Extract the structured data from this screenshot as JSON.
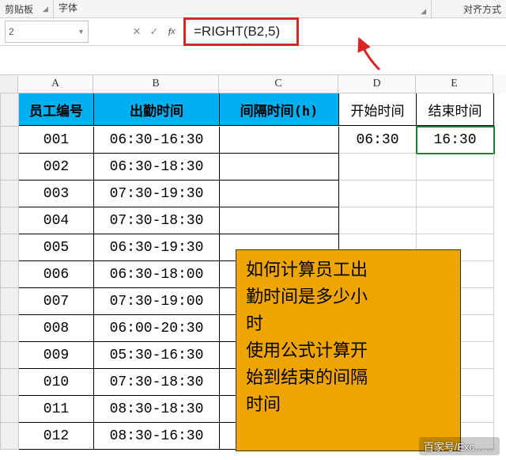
{
  "ribbon": {
    "clipboard": "剪贴板",
    "font": "字体",
    "alignment": "对齐方式"
  },
  "formula_bar": {
    "namebox": "2",
    "formula": "=RIGHT(B2,5)"
  },
  "columns": {
    "A": "A",
    "B": "B",
    "C": "C",
    "D": "D",
    "E": "E"
  },
  "headers": {
    "A": "员工编号",
    "B": "出勤时间",
    "C": "间隔时间(h)",
    "D": "开始时间",
    "E": "结束时间"
  },
  "rows": [
    {
      "A": "001",
      "B": "06:30-16:30",
      "C": "",
      "D": "06:30",
      "E": "16:30"
    },
    {
      "A": "002",
      "B": "06:30-18:30",
      "C": "",
      "D": "",
      "E": ""
    },
    {
      "A": "003",
      "B": "07:30-19:30",
      "C": "",
      "D": "",
      "E": ""
    },
    {
      "A": "004",
      "B": "07:30-18:30",
      "C": "",
      "D": "",
      "E": ""
    },
    {
      "A": "005",
      "B": "06:30-19:30",
      "C": "",
      "D": "",
      "E": ""
    },
    {
      "A": "006",
      "B": "06:30-18:00",
      "C": "",
      "D": "",
      "E": ""
    },
    {
      "A": "007",
      "B": "07:30-19:00",
      "C": "",
      "D": "",
      "E": ""
    },
    {
      "A": "008",
      "B": "06:00-20:30",
      "C": "",
      "D": "",
      "E": ""
    },
    {
      "A": "009",
      "B": "05:30-16:30",
      "C": "",
      "D": "",
      "E": ""
    },
    {
      "A": "010",
      "B": "07:30-18:30",
      "C": "",
      "D": "",
      "E": ""
    },
    {
      "A": "011",
      "B": "08:30-18:30",
      "C": "",
      "D": "",
      "E": ""
    },
    {
      "A": "012",
      "B": "08:30-16:30",
      "C": "",
      "D": "",
      "E": ""
    }
  ],
  "overlay": {
    "line1": "如何计算员工出",
    "line2": "勤时间是多少小",
    "line3": "时",
    "line4": "使用公式计算开",
    "line5": "始到结束的间隔",
    "line6": "时间"
  },
  "watermark": "百家号/Exc……"
}
